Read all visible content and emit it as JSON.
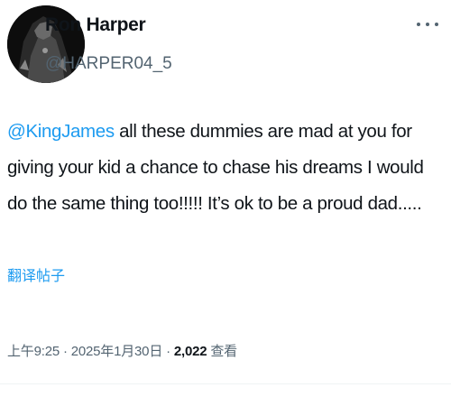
{
  "author": {
    "display_name": "Ron Harper",
    "handle": "@HARPER04_5",
    "avatar_icon": "profile-photo"
  },
  "tweet": {
    "mention": "@KingJames",
    "text": " all these dummies are mad at you for giving your kid a chance to chase his dreams I would do the same thing too!!!!! It’s ok to be a proud dad.....",
    "translate_label": "翻译帖子"
  },
  "meta": {
    "timestamp": "上午9:25 · 2025年1月30日 · ",
    "views_count": "2,022",
    "views_label": " 查看"
  },
  "icons": {
    "more": "more-options-icon"
  },
  "colors": {
    "link": "#1d9bf0",
    "secondary_text": "#536471",
    "primary_text": "#0f1419"
  }
}
